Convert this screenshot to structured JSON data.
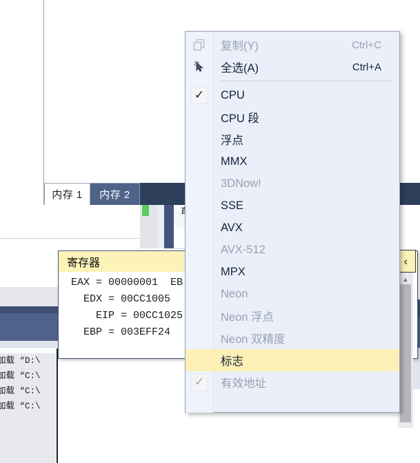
{
  "app": {
    "tabs": [
      {
        "label": "内存 1",
        "active": true
      },
      {
        "label": "内存 2",
        "active": false
      }
    ],
    "fragment_glyph": "直"
  },
  "register_window": {
    "title": "寄存器",
    "lines": [
      "  EAX = 00000001  EB",
      "    EDX = 00CC1005 ",
      "      EIP = 00CC1025",
      "    EBP = 003EFF24"
    ]
  },
  "log_panel": {
    "lines": [
      "加载 “D:\\",
      "加载 “C:\\",
      "加载 “C:\\",
      "加载 “C:\\"
    ]
  },
  "right_panel": {
    "chevron": "‹",
    "scroll_up_arrow": "▲"
  },
  "context_menu": {
    "items": [
      {
        "label": "复制(Y)",
        "accel": "Ctrl+C",
        "icon": "copy-icon",
        "state": "disabled",
        "checked": false
      },
      {
        "label": "全选(A)",
        "accel": "Ctrl+A",
        "icon": "select-all-icon",
        "state": "enabled",
        "checked": false
      },
      {
        "separator": true
      },
      {
        "label": "CPU",
        "accel": "",
        "icon": "",
        "state": "enabled",
        "checked": true
      },
      {
        "label": "CPU 段",
        "accel": "",
        "icon": "",
        "state": "enabled",
        "checked": false
      },
      {
        "label": "浮点",
        "accel": "",
        "icon": "",
        "state": "enabled",
        "checked": false
      },
      {
        "label": "MMX",
        "accel": "",
        "icon": "",
        "state": "enabled",
        "checked": false
      },
      {
        "label": "3DNow!",
        "accel": "",
        "icon": "",
        "state": "disabled",
        "checked": false
      },
      {
        "label": "SSE",
        "accel": "",
        "icon": "",
        "state": "enabled",
        "checked": false
      },
      {
        "label": "AVX",
        "accel": "",
        "icon": "",
        "state": "enabled",
        "checked": false
      },
      {
        "label": "AVX-512",
        "accel": "",
        "icon": "",
        "state": "disabled",
        "checked": false
      },
      {
        "label": "MPX",
        "accel": "",
        "icon": "",
        "state": "enabled",
        "checked": false
      },
      {
        "label": "Neon",
        "accel": "",
        "icon": "",
        "state": "disabled",
        "checked": false
      },
      {
        "label": "Neon 浮点",
        "accel": "",
        "icon": "",
        "state": "disabled",
        "checked": false
      },
      {
        "label": "Neon 双精度",
        "accel": "",
        "icon": "",
        "state": "disabled",
        "checked": false
      },
      {
        "label": "标志",
        "accel": "",
        "icon": "",
        "state": "highlight",
        "checked": false
      },
      {
        "label": "有效地址",
        "accel": "",
        "icon": "",
        "state": "disabled",
        "checked": true
      }
    ]
  },
  "colors": {
    "menu_bg": "#eaeff9",
    "menu_gutter": "#eff3fb",
    "highlight": "#fcf0b4",
    "tab_active_bg": "#ffffff",
    "tab_inactive_bg": "#4f6288",
    "tabstrip_bg": "#2e3f5c",
    "register_title_bg": "#fdf3b8",
    "disabled_text": "#9aa2b2",
    "text": "#13233d",
    "marker_green": "#5ccc5c"
  }
}
